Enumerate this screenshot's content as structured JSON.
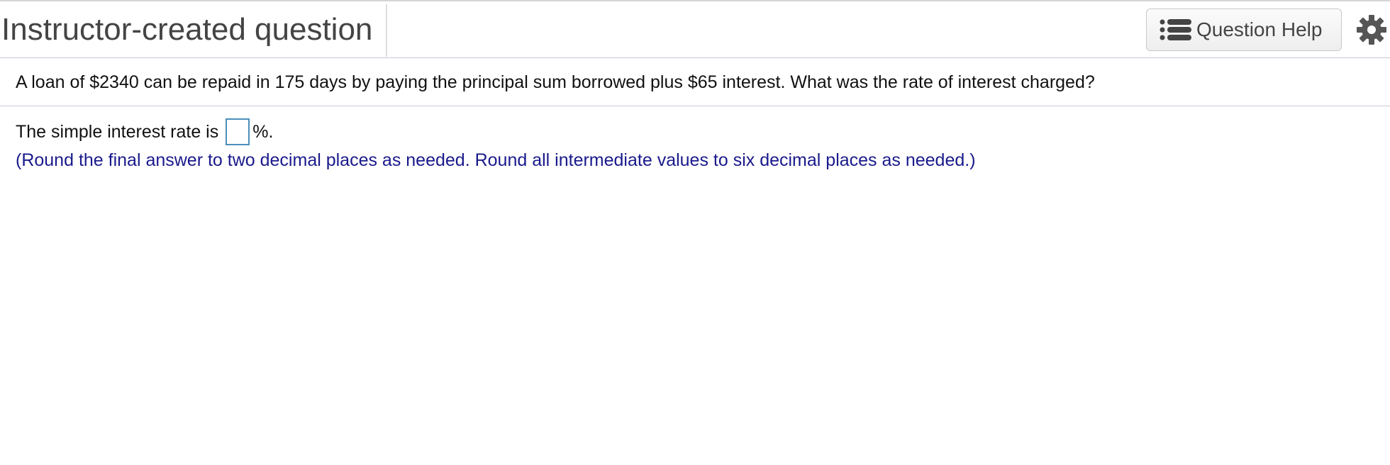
{
  "header": {
    "title": "Instructor-created question",
    "help_button": {
      "label": "Question Help",
      "icon": "list-icon"
    },
    "settings_icon": "gear-icon"
  },
  "question": {
    "text": "A loan of $2340 can be repaid in 175 days by paying the principal sum borrowed plus $65 interest. What was the rate of interest charged?"
  },
  "answer": {
    "prefix": "The simple interest rate is",
    "input_value": "",
    "suffix": "%.",
    "hint": "(Round the final answer to two decimal places as needed. Round all intermediate values to six decimal places as needed.)"
  },
  "colors": {
    "title_text": "#444444",
    "hint_text": "#1a1a8c",
    "input_border": "#4a8fbd",
    "divider": "#c9c9d6"
  }
}
